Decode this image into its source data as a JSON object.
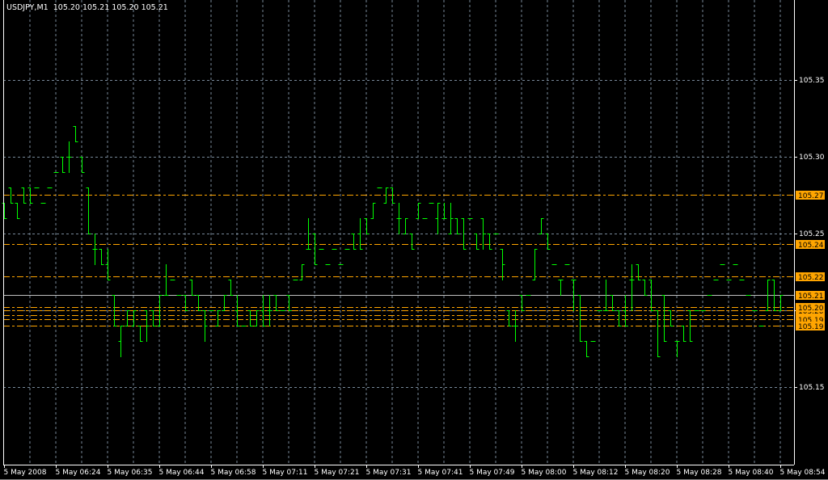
{
  "window": {
    "symbol": "USDJPY,M1",
    "ohlc_readout": [
      "105.20",
      "105.21",
      "105.20",
      "105.21"
    ]
  },
  "colors": {
    "background": "#000000",
    "bars": "#00ff00",
    "grid": "#778899",
    "level_lines": "#ffa500",
    "bid_line": "#c0c0c0",
    "axis": "#ffffff"
  },
  "price_axis": {
    "labels": [
      {
        "value": 105.35,
        "text": "105.35"
      },
      {
        "value": 105.3,
        "text": "105.30"
      },
      {
        "value": 105.25,
        "text": "105.25"
      },
      {
        "value": 105.2,
        "text": ""
      },
      {
        "value": 105.15,
        "text": "105.15"
      }
    ]
  },
  "levels": [
    {
      "value": 105.275,
      "label": "105.27"
    },
    {
      "value": 105.243,
      "label": "105.24"
    },
    {
      "value": 105.222,
      "label": "105.22"
    },
    {
      "value": 105.21,
      "label": "105.21",
      "bid": true
    },
    {
      "value": 105.197,
      "label": "105.19"
    },
    {
      "value": 105.194,
      "label": "105.19"
    },
    {
      "value": 105.19,
      "label": "105.19"
    },
    {
      "value": 105.2,
      "label": "105.20"
    },
    {
      "value": 105.202,
      "label": "105.20"
    }
  ],
  "time_axis": {
    "labels": [
      "5 May 2008",
      "5 May 06:24",
      "5 May 06:35",
      "5 May 06:44",
      "5 May 06:58",
      "5 May 07:11",
      "5 May 07:21",
      "5 May 07:31",
      "5 May 07:41",
      "5 May 07:49",
      "5 May 08:00",
      "5 May 08:12",
      "5 May 08:20",
      "5 May 08:28",
      "5 May 08:40",
      "5 May 08:54"
    ],
    "bars_per_label": 8
  },
  "chart_data": {
    "type": "ohlc",
    "symbol": "USDJPY",
    "timeframe": "M1",
    "ylim": [
      105.1,
      105.4
    ],
    "grid": true,
    "ohlc": [
      [
        105.27,
        105.27,
        105.26,
        105.26
      ],
      [
        105.28,
        105.28,
        105.27,
        105.27
      ],
      [
        105.27,
        105.27,
        105.26,
        105.26
      ],
      [
        105.28,
        105.28,
        105.27,
        105.27
      ],
      [
        105.28,
        105.28,
        105.27,
        105.27
      ],
      [
        105.28,
        105.28,
        105.28,
        105.28
      ],
      [
        105.27,
        105.27,
        105.27,
        105.27
      ],
      [
        105.28,
        105.28,
        105.28,
        105.28
      ],
      [
        105.29,
        105.29,
        105.29,
        105.29
      ],
      [
        105.3,
        105.3,
        105.29,
        105.29
      ],
      [
        105.3,
        105.31,
        105.29,
        105.3
      ],
      [
        105.32,
        105.32,
        105.31,
        105.31
      ],
      [
        105.3,
        105.3,
        105.29,
        105.29
      ],
      [
        105.28,
        105.28,
        105.25,
        105.25
      ],
      [
        105.24,
        105.25,
        105.23,
        105.24
      ],
      [
        105.24,
        105.24,
        105.23,
        105.23
      ],
      [
        105.23,
        105.24,
        105.22,
        105.22
      ],
      [
        105.21,
        105.21,
        105.19,
        105.19
      ],
      [
        105.18,
        105.19,
        105.17,
        105.19
      ],
      [
        105.19,
        105.2,
        105.19,
        105.2
      ],
      [
        105.19,
        105.2,
        105.19,
        105.2
      ],
      [
        105.19,
        105.19,
        105.18,
        105.18
      ],
      [
        105.2,
        105.2,
        105.18,
        105.19
      ],
      [
        105.2,
        105.2,
        105.19,
        105.19
      ],
      [
        105.19,
        105.21,
        105.19,
        105.21
      ],
      [
        105.21,
        105.23,
        105.21,
        105.21
      ],
      [
        105.22,
        105.22,
        105.22,
        105.22
      ],
      [
        105.21,
        105.21,
        105.21,
        105.21
      ],
      [
        105.21,
        105.21,
        105.2,
        105.2
      ],
      [
        105.22,
        105.22,
        105.21,
        105.21
      ],
      [
        105.21,
        105.21,
        105.2,
        105.2
      ],
      [
        105.2,
        105.2,
        105.18,
        105.19
      ],
      [
        105.2,
        105.2,
        105.2,
        105.2
      ],
      [
        105.19,
        105.2,
        105.19,
        105.2
      ],
      [
        105.2,
        105.21,
        105.2,
        105.21
      ],
      [
        105.22,
        105.22,
        105.21,
        105.21
      ],
      [
        105.2,
        105.21,
        105.19,
        105.19
      ],
      [
        105.19,
        105.19,
        105.19,
        105.19
      ],
      [
        105.2,
        105.2,
        105.19,
        105.19
      ],
      [
        105.19,
        105.2,
        105.19,
        105.2
      ],
      [
        105.2,
        105.21,
        105.19,
        105.19
      ],
      [
        105.2,
        105.21,
        105.19,
        105.2
      ],
      [
        105.21,
        105.21,
        105.2,
        105.2
      ],
      [
        105.2,
        105.2,
        105.2,
        105.2
      ],
      [
        105.21,
        105.21,
        105.2,
        105.2
      ],
      [
        105.22,
        105.22,
        105.22,
        105.22
      ],
      [
        105.22,
        105.23,
        105.22,
        105.23
      ],
      [
        105.24,
        105.26,
        105.24,
        105.24
      ],
      [
        105.25,
        105.25,
        105.23,
        105.23
      ],
      [
        105.24,
        105.24,
        105.24,
        105.24
      ],
      [
        105.23,
        105.23,
        105.23,
        105.23
      ],
      [
        105.24,
        105.24,
        105.24,
        105.24
      ],
      [
        105.23,
        105.23,
        105.23,
        105.23
      ],
      [
        105.24,
        105.24,
        105.24,
        105.24
      ],
      [
        105.25,
        105.25,
        105.24,
        105.24
      ],
      [
        105.25,
        105.26,
        105.24,
        105.24
      ],
      [
        105.26,
        105.26,
        105.25,
        105.25
      ],
      [
        105.26,
        105.27,
        105.26,
        105.27
      ],
      [
        105.28,
        105.28,
        105.28,
        105.28
      ],
      [
        105.27,
        105.28,
        105.27,
        105.28
      ],
      [
        105.28,
        105.28,
        105.27,
        105.27
      ],
      [
        105.26,
        105.27,
        105.25,
        105.26
      ],
      [
        105.25,
        105.26,
        105.25,
        105.26
      ],
      [
        105.25,
        105.25,
        105.24,
        105.24
      ],
      [
        105.26,
        105.27,
        105.26,
        105.27
      ],
      [
        105.26,
        105.26,
        105.26,
        105.26
      ],
      [
        105.27,
        105.27,
        105.27,
        105.27
      ],
      [
        105.26,
        105.27,
        105.25,
        105.27
      ],
      [
        105.26,
        105.27,
        105.26,
        105.26
      ],
      [
        105.25,
        105.27,
        105.25,
        105.26
      ],
      [
        105.26,
        105.26,
        105.25,
        105.25
      ],
      [
        105.26,
        105.26,
        105.24,
        105.24
      ],
      [
        105.26,
        105.26,
        105.26,
        105.26
      ],
      [
        105.25,
        105.25,
        105.24,
        105.24
      ],
      [
        105.26,
        105.26,
        105.24,
        105.25
      ],
      [
        105.25,
        105.25,
        105.24,
        105.24
      ],
      [
        105.25,
        105.25,
        105.25,
        105.25
      ],
      [
        105.24,
        105.24,
        105.22,
        105.23
      ],
      [
        105.2,
        105.2,
        105.19,
        105.19
      ],
      [
        105.19,
        105.2,
        105.18,
        105.19
      ],
      [
        105.21,
        105.21,
        105.2,
        105.2
      ],
      [
        105.21,
        105.21,
        105.21,
        105.21
      ],
      [
        105.22,
        105.24,
        105.22,
        105.24
      ],
      [
        105.25,
        105.26,
        105.25,
        105.26
      ],
      [
        105.25,
        105.25,
        105.24,
        105.24
      ],
      [
        105.23,
        105.23,
        105.23,
        105.23
      ],
      [
        105.22,
        105.22,
        105.21,
        105.22
      ],
      [
        105.23,
        105.23,
        105.23,
        105.23
      ],
      [
        105.22,
        105.22,
        105.2,
        105.22
      ],
      [
        105.21,
        105.21,
        105.18,
        105.18
      ],
      [
        105.18,
        105.18,
        105.17,
        105.17
      ],
      [
        105.18,
        105.18,
        105.18,
        105.18
      ],
      [
        105.2,
        105.2,
        105.2,
        105.2
      ],
      [
        105.2,
        105.22,
        105.2,
        105.2
      ],
      [
        105.21,
        105.21,
        105.2,
        105.2
      ],
      [
        105.2,
        105.2,
        105.19,
        105.19
      ],
      [
        105.2,
        105.21,
        105.19,
        105.19
      ],
      [
        105.22,
        105.23,
        105.2,
        105.22
      ],
      [
        105.23,
        105.23,
        105.22,
        105.22
      ],
      [
        105.22,
        105.22,
        105.21,
        105.21
      ],
      [
        105.22,
        105.22,
        105.2,
        105.2
      ],
      [
        105.2,
        105.2,
        105.17,
        105.17
      ],
      [
        105.21,
        105.21,
        105.18,
        105.18
      ],
      [
        105.2,
        105.2,
        105.19,
        105.19
      ],
      [
        105.18,
        105.18,
        105.17,
        105.18
      ],
      [
        105.19,
        105.19,
        105.18,
        105.18
      ],
      [
        105.2,
        105.2,
        105.18,
        105.18
      ],
      [
        105.2,
        105.2,
        105.2,
        105.2
      ],
      [
        105.2,
        105.2,
        105.2,
        105.2
      ],
      [
        105.21,
        105.21,
        105.21,
        105.21
      ],
      [
        105.22,
        105.22,
        105.22,
        105.22
      ],
      [
        105.23,
        105.23,
        105.23,
        105.23
      ],
      [
        105.22,
        105.22,
        105.22,
        105.22
      ],
      [
        105.23,
        105.23,
        105.23,
        105.23
      ],
      [
        105.22,
        105.22,
        105.22,
        105.22
      ],
      [
        105.21,
        105.21,
        105.21,
        105.21
      ],
      [
        105.2,
        105.2,
        105.2,
        105.2
      ],
      [
        105.19,
        105.19,
        105.19,
        105.19
      ],
      [
        105.2,
        105.22,
        105.2,
        105.22
      ],
      [
        105.22,
        105.22,
        105.2,
        105.2
      ],
      [
        105.2,
        105.21,
        105.2,
        105.21
      ]
    ]
  }
}
